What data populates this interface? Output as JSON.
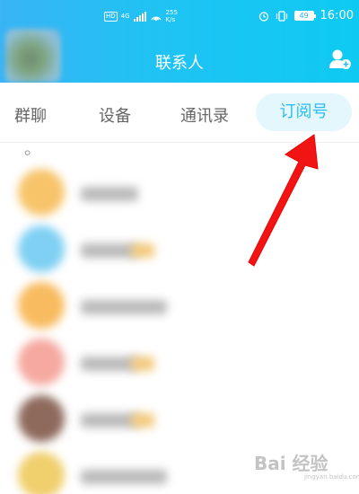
{
  "status_bar": {
    "network_badge": "HD",
    "network_type": "4G",
    "speed_value": "255",
    "speed_unit": "K/s",
    "battery": "49",
    "time": "16:00"
  },
  "header": {
    "title": "联系人",
    "add_contact_icon": "add-person-icon"
  },
  "tabs": [
    {
      "label": "群聊",
      "active": false
    },
    {
      "label": "设备",
      "active": false
    },
    {
      "label": "通讯录",
      "active": false
    },
    {
      "label": "订阅号",
      "active": true
    }
  ],
  "search_glyph": "ㅇ",
  "contacts": [
    {
      "avatar_color": "#f7c46a",
      "has_tag": false
    },
    {
      "avatar_color": "#7fd0f3",
      "has_tag": true
    },
    {
      "avatar_color": "#f8bb5f",
      "has_tag": false
    },
    {
      "avatar_color": "#f5a9a0",
      "has_tag": true
    },
    {
      "avatar_color": "#8e6a5c",
      "has_tag": true
    },
    {
      "avatar_color": "#f0cf6d",
      "has_tag": false
    }
  ],
  "colors": {
    "header_gradient_start": "#39b4f5",
    "header_gradient_end": "#0ecaf2",
    "tab_active_text": "#2bbcf1",
    "tab_active_bg": "#e3f7fd",
    "annotation_arrow": "#f01414"
  },
  "watermark": {
    "main": "Bai 经验",
    "sub": "jingyan.baidu.com"
  }
}
